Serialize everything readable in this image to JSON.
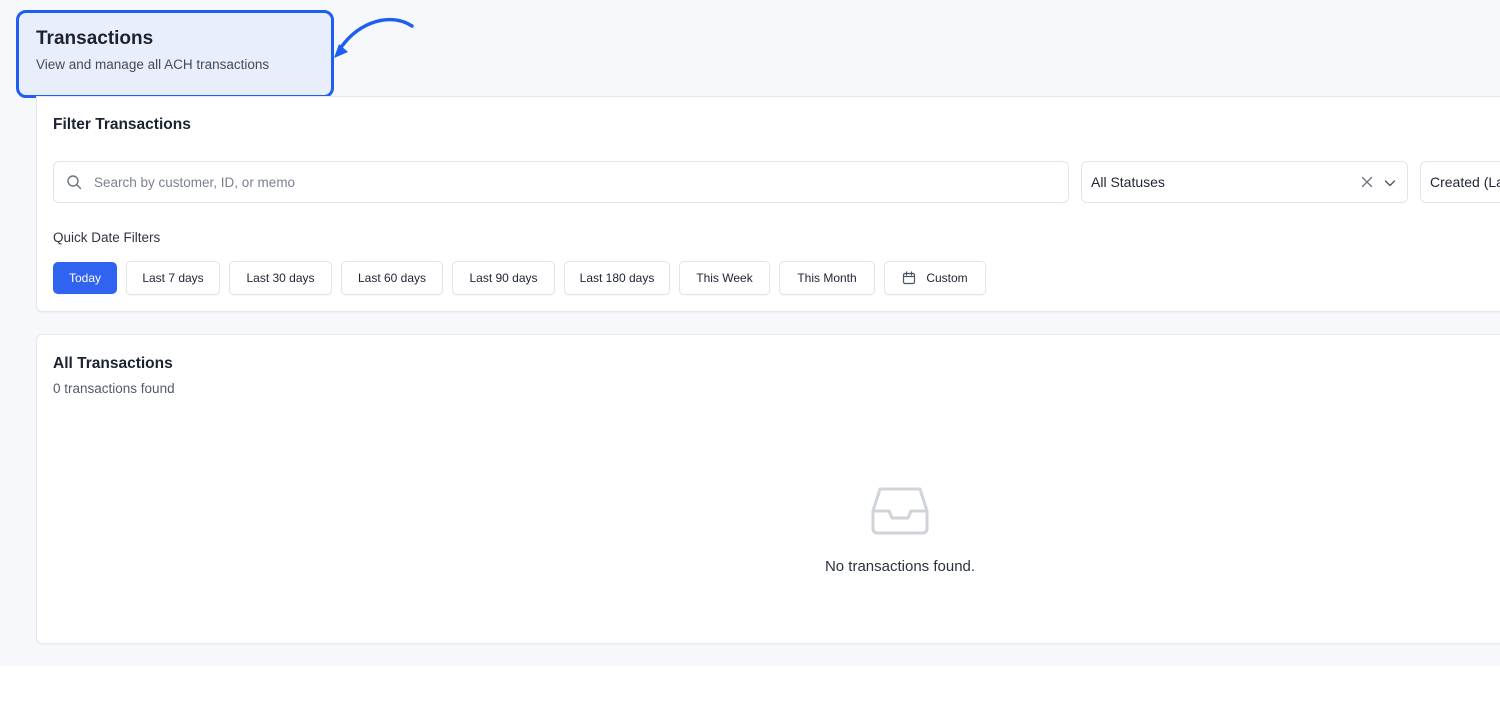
{
  "header": {
    "title": "Transactions",
    "subtitle": "View and manage all ACH transactions"
  },
  "filters": {
    "title": "Filter Transactions",
    "search": {
      "placeholder": "Search by customer, ID, or memo",
      "value": ""
    },
    "status_select": {
      "value": "All Statuses"
    },
    "sort_select": {
      "value": "Created (La"
    },
    "quick_date_label": "Quick Date Filters",
    "quick_dates": [
      {
        "label": "Today",
        "active": true
      },
      {
        "label": "Last 7 days",
        "active": false
      },
      {
        "label": "Last 30 days",
        "active": false
      },
      {
        "label": "Last 60 days",
        "active": false
      },
      {
        "label": "Last 90 days",
        "active": false
      },
      {
        "label": "Last 180 days",
        "active": false
      },
      {
        "label": "This Week",
        "active": false
      },
      {
        "label": "This Month",
        "active": false
      },
      {
        "label": "Custom",
        "active": false,
        "icon": "calendar-icon"
      }
    ]
  },
  "transactions": {
    "title": "All Transactions",
    "count_text": "0 transactions found",
    "empty_icon": "inbox-icon",
    "empty_text": "No transactions found."
  },
  "colors": {
    "accent": "#2f63f0",
    "callout_border": "#1e5ef0",
    "callout_bg": "#e9eefc",
    "page_bg": "#f7f8fb"
  }
}
